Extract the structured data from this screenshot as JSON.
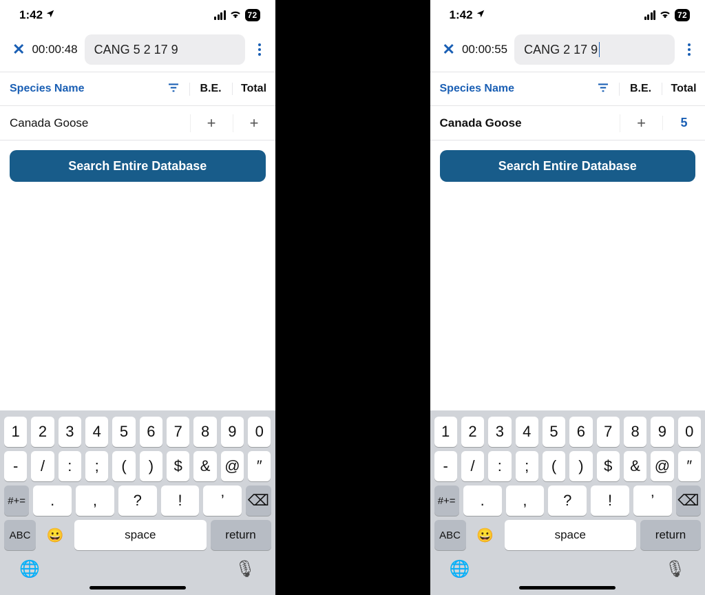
{
  "status": {
    "time": "1:42",
    "battery": "72"
  },
  "screens": [
    {
      "timer": "00:00:48",
      "search_value": "CANG 5 2 17 9",
      "show_caret": false,
      "row": {
        "species": "Canada Goose",
        "species_bold": false,
        "be": "+",
        "total_mode": "plus",
        "total_value": "+"
      }
    },
    {
      "timer": "00:00:55",
      "search_value": "CANG  2 17 9",
      "show_caret": true,
      "row": {
        "species": "Canada Goose",
        "species_bold": true,
        "be": "+",
        "total_mode": "num",
        "total_value": "5"
      }
    }
  ],
  "headers": {
    "species": "Species Name",
    "be": "B.E.",
    "total": "Total"
  },
  "cta": "Search Entire Database",
  "keyboard": {
    "row1": [
      "1",
      "2",
      "3",
      "4",
      "5",
      "6",
      "7",
      "8",
      "9",
      "0"
    ],
    "row2": [
      "-",
      "/",
      ":",
      ";",
      "(",
      ")",
      "$",
      "&",
      "@",
      "″"
    ],
    "row3_side_left": "#+=",
    "row3": [
      ".",
      ",",
      "?",
      "!",
      "’"
    ],
    "row3_backspace": "⌫",
    "row4": {
      "abc": "ABC",
      "emoji": "😀",
      "space": "space",
      "ret": "return"
    },
    "globe": "🌐",
    "mic": "🎙"
  }
}
